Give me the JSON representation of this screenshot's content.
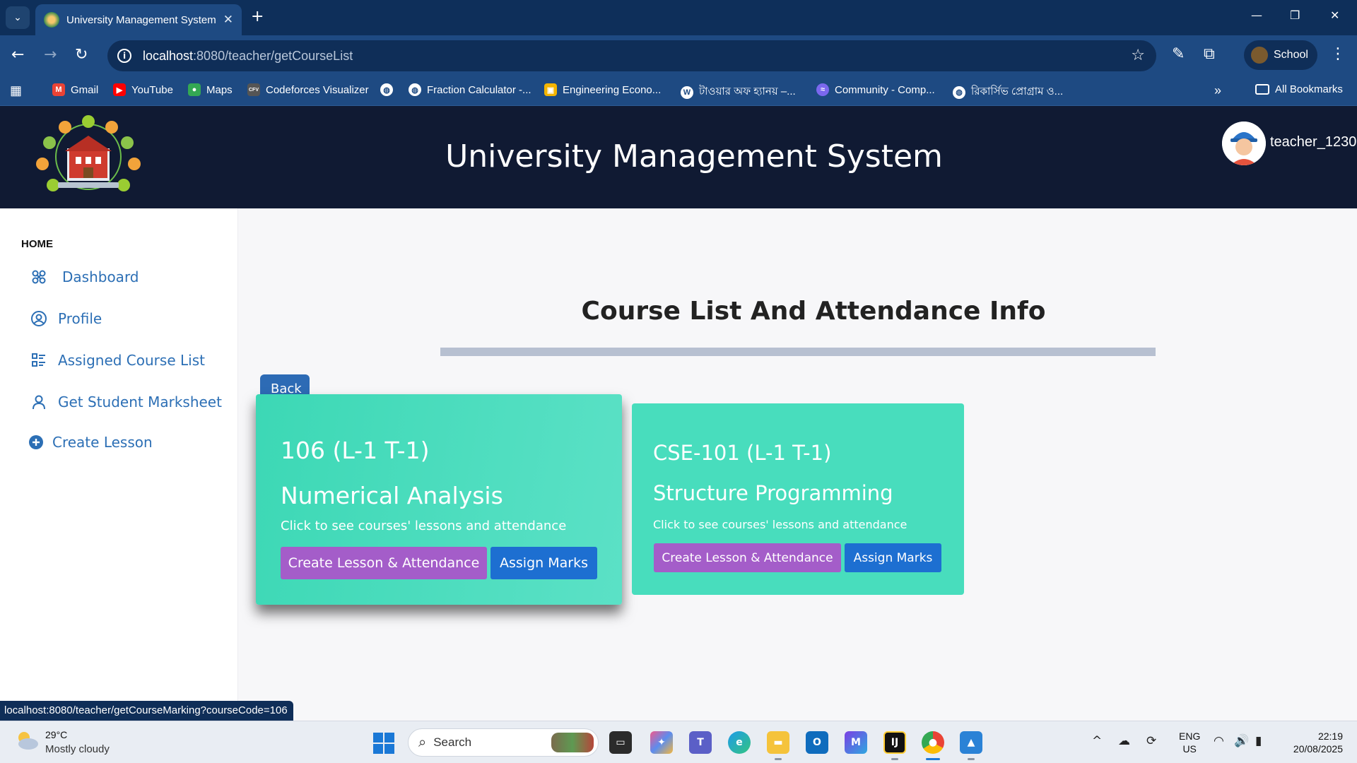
{
  "browser": {
    "tab_title": "University Management System",
    "url_host": "localhost",
    "url_path": ":8080/teacher/getCourseList",
    "profile_name": "School",
    "bookmarks": [
      {
        "label": "Gmail",
        "icon": "gmail-icon",
        "color": "#ea4335"
      },
      {
        "label": "YouTube",
        "icon": "youtube-icon",
        "color": "#ff0000"
      },
      {
        "label": "Maps",
        "icon": "maps-icon",
        "color": "#34a853"
      },
      {
        "label": "Codeforces Visualizer",
        "icon": "cfv-icon",
        "color": "#555555"
      },
      {
        "label": "",
        "icon": "globe-icon",
        "color": "#ffffff"
      },
      {
        "label": "Fraction Calculator -...",
        "icon": "globe-icon",
        "color": "#ffffff"
      },
      {
        "label": "Engineering Econo...",
        "icon": "classroom-icon",
        "color": "#f4b400"
      },
      {
        "label": "টাওয়ার অফ হ্যানয় –...",
        "icon": "wordpress-icon",
        "color": "#ffffff"
      },
      {
        "label": "Community - Comp...",
        "icon": "community-icon",
        "color": "#7b68ee"
      },
      {
        "label": "রিকার্সিভ প্রোগ্রাম ও...",
        "icon": "globe-icon",
        "color": "#ffffff"
      }
    ],
    "all_bookmarks": "All Bookmarks",
    "status_url": "localhost:8080/teacher/getCourseMarking?courseCode=106"
  },
  "app": {
    "title": "University Management System",
    "username": "teacher_1230"
  },
  "sidebar": {
    "heading": "HOME",
    "items": [
      {
        "label": "Dashboard",
        "icon": "dashboard-icon"
      },
      {
        "label": "Profile",
        "icon": "profile-icon"
      },
      {
        "label": "Assigned Course List",
        "icon": "list-icon"
      },
      {
        "label": "Get Student Marksheet",
        "icon": "person-icon"
      },
      {
        "label": "Create Lesson",
        "icon": "plus-circle-icon"
      }
    ]
  },
  "main": {
    "title": "Course List And Attendance Info",
    "back_label": "Back",
    "courses": [
      {
        "code": "106 (L-1 T-1)",
        "name": "Numerical Analysis",
        "hint": "Click to see courses' lessons and attendance",
        "create_label": "Create Lesson & Attendance",
        "assign_label": "Assign Marks"
      },
      {
        "code": "CSE-101 (L-1 T-1)",
        "name": "Structure Programming",
        "hint": "Click to see courses' lessons and attendance",
        "create_label": "Create Lesson & Attendance",
        "assign_label": "Assign Marks"
      }
    ]
  },
  "taskbar": {
    "temperature": "29°C",
    "weather": "Mostly cloudy",
    "search_placeholder": "Search",
    "lang_1": "ENG",
    "lang_2": "US",
    "time": "22:19",
    "date": "20/08/2025"
  },
  "colors": {
    "header_bg": "#101a33",
    "card_bg": "#48ddbd",
    "purple_btn": "#a45dc9",
    "blue_btn": "#1d6fd1",
    "link_blue": "#2c6fb5"
  }
}
